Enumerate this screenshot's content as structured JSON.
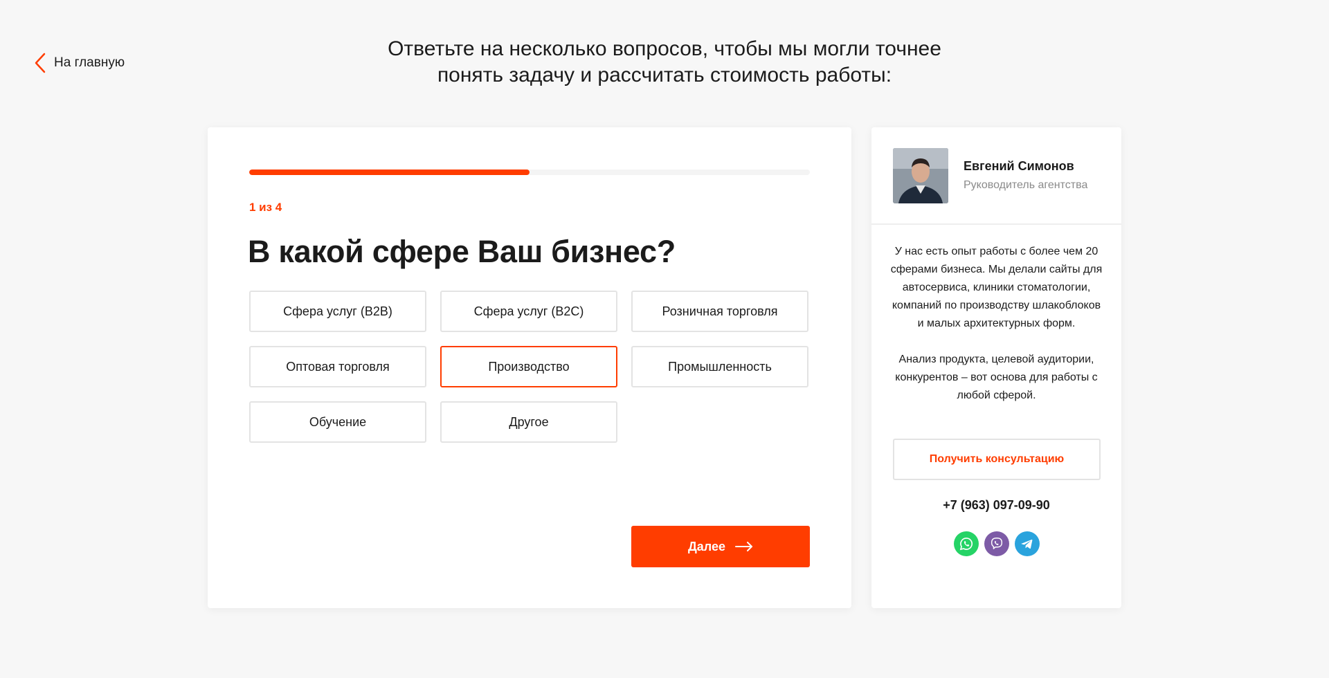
{
  "nav": {
    "back_label": "На главную"
  },
  "headline": {
    "line1": "Ответьте на несколько вопросов, чтобы мы могли точнее",
    "line2": "понять задачу и рассчитать стоимость работы:"
  },
  "quiz": {
    "progress": 0.5,
    "step": "1 из 4",
    "question": "В какой сфере Ваш бизнес?",
    "options": [
      {
        "label": "Сфера услуг (B2B)",
        "selected": false
      },
      {
        "label": "Сфера услуг (B2C)",
        "selected": false
      },
      {
        "label": "Розничная торговля",
        "selected": false
      },
      {
        "label": "Оптовая торговля",
        "selected": false
      },
      {
        "label": "Производство",
        "selected": true
      },
      {
        "label": "Промышленность",
        "selected": false
      },
      {
        "label": "Обучение",
        "selected": false
      },
      {
        "label": "Другое",
        "selected": false
      }
    ],
    "next_label": "Далее"
  },
  "manager": {
    "name": "Евгений Симонов",
    "role": "Руководитель агентства",
    "description_1": "У нас есть опыт работы с более чем 20 сферами бизнеса. Мы делали сайты для автосервиса, клиники стоматологии, компаний по производству шлакоблоков и малых архитектурных форм.",
    "description_2": "Анализ продукта, целевой аудитории, конкурентов – вот основа для работы с любой сферой.",
    "consult_label": "Получить консультацию",
    "phone": "+7 (963) 097-09-90"
  },
  "messengers": [
    {
      "name": "whatsapp-icon",
      "color": "#25d366"
    },
    {
      "name": "viber-icon",
      "color": "#7d5ba6"
    },
    {
      "name": "telegram-icon",
      "color": "#2aa3dd"
    }
  ],
  "colors": {
    "accent": "#ff3d00",
    "border": "#e3e3e3",
    "background": "#f7f7f7"
  }
}
